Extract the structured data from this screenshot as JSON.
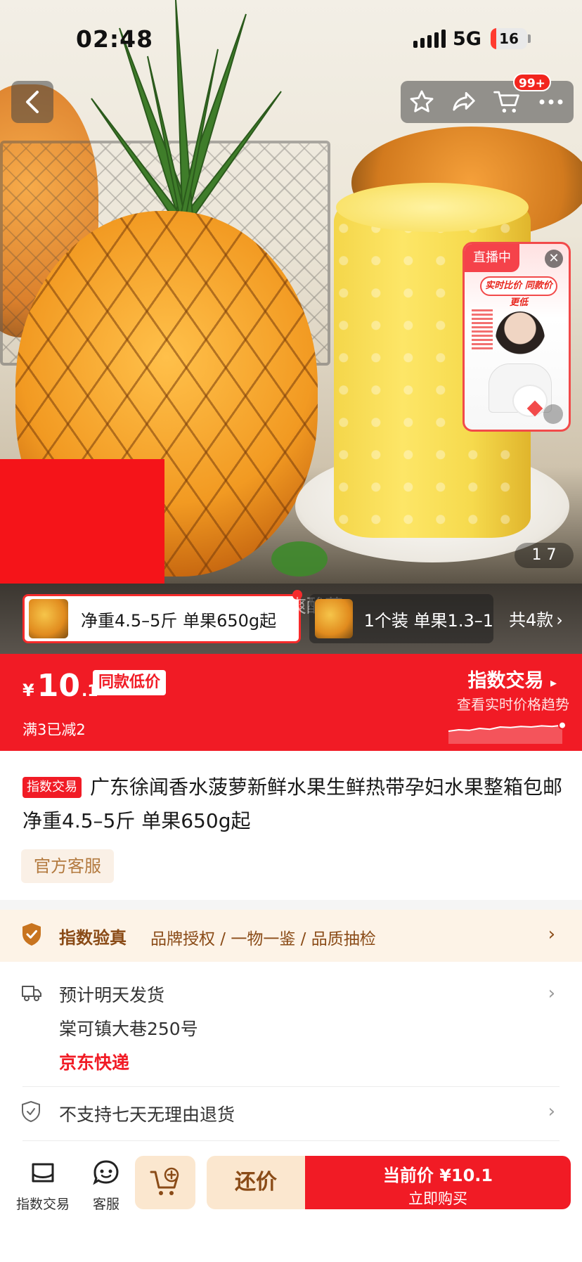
{
  "status_bar": {
    "time": "02:48",
    "network": "5G",
    "battery": "16",
    "battery_level": 0.16
  },
  "nav": {
    "cart_badge": "99+"
  },
  "live": {
    "tag": "直播中",
    "close": "✕",
    "banner": "实时比价 同款价更低"
  },
  "gallery": {
    "counter": "1  7"
  },
  "variants": {
    "selected_label": "净重4.5–5斤 单果650g起",
    "second_label": "1个装 单果1.3–1",
    "total": "共4款",
    "overlay_text": "撒尔上的老爽酸菜"
  },
  "price": {
    "currency": "¥",
    "integer": "10",
    "decimal": ".1",
    "badge": "同款低价",
    "promo": "满3已减2",
    "index_title": "指数交易",
    "index_sub": "查看实时价格趋势",
    "trend_points": [
      0.55,
      0.5,
      0.52,
      0.45,
      0.48,
      0.4,
      0.42,
      0.38,
      0.4,
      0.36,
      0.38,
      0.34
    ]
  },
  "product": {
    "tag": "指数交易",
    "title": "广东徐闻香水菠萝新鲜水果生鲜热带孕妇水果整箱包邮 净重4.5–5斤 单果650g起",
    "service_button": "官方客服"
  },
  "auth": {
    "title": "指数验真",
    "subtitle": "品牌授权 / 一物一鉴 / 品质抽检"
  },
  "delivery": {
    "line1": "预计明天发货",
    "line2": "棠可镇大巷250号",
    "carrier": "京东快递"
  },
  "returns": {
    "text": "不支持七天无理由退货"
  },
  "bottom_bar": {
    "index_label": "指数交易",
    "service_label": "客服",
    "bargain": "还价",
    "buy_line1": "当前价 ¥10.1",
    "buy_line2": "立即购买"
  },
  "colors": {
    "brand_red": "#f11b25",
    "gold": "#8a4b17",
    "cream": "#fbe7cf"
  }
}
